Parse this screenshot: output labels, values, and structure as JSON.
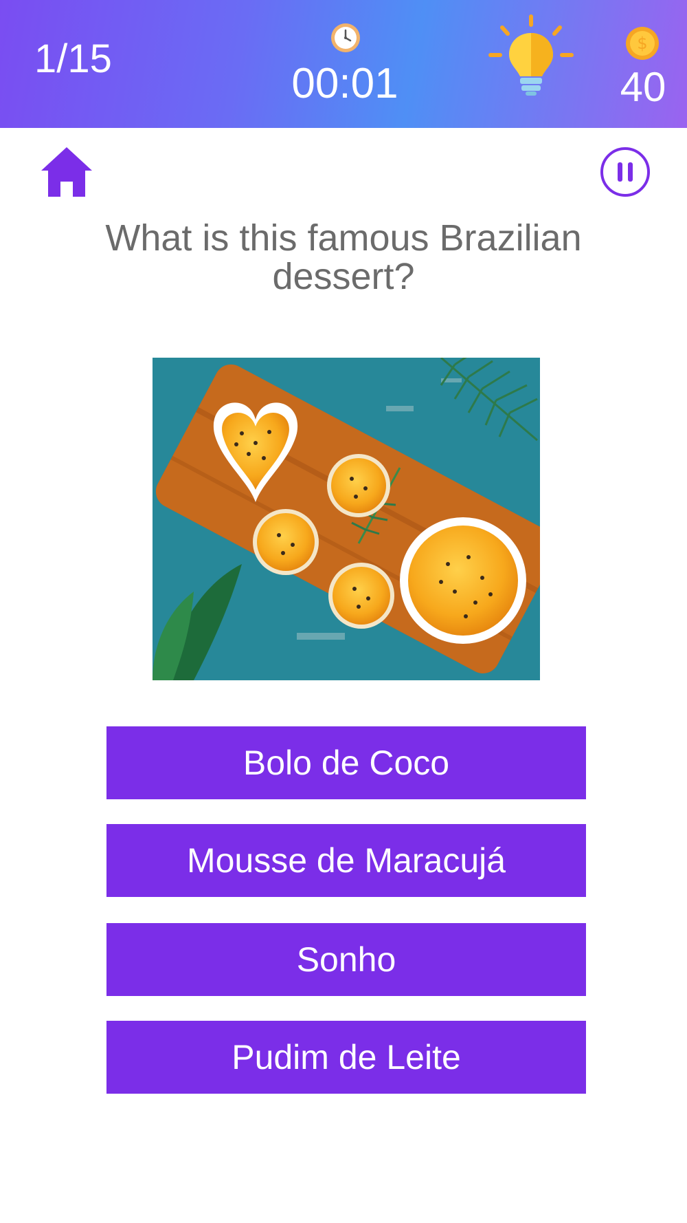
{
  "header": {
    "progress": "1/15",
    "timer": "00:01",
    "coins": "40",
    "clock_icon": "alarm-clock-icon",
    "hint_icon": "lightbulb-icon",
    "coin_icon": "dollar-coin-icon"
  },
  "nav": {
    "home_icon": "home-icon",
    "pause_icon": "pause-icon"
  },
  "question": {
    "text": "What is this famous Brazilian dessert?",
    "image": "passion-fruit-mousse-photo"
  },
  "answers": [
    {
      "label": "Bolo de Coco"
    },
    {
      "label": "Mousse de Maracujá"
    },
    {
      "label": "Sonho"
    },
    {
      "label": "Pudim de Leite"
    }
  ],
  "colors": {
    "accent": "#7b2ee8",
    "header_gradient_start": "#7a4df2",
    "header_gradient_mid": "#4f8ff5",
    "question_text": "#6b6b6b"
  }
}
